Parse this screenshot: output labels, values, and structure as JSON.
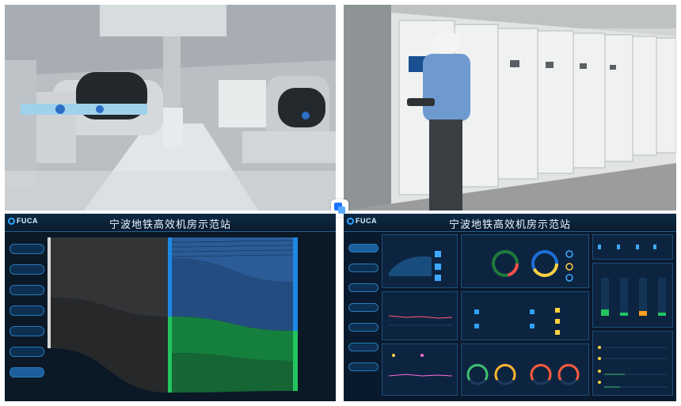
{
  "screens": {
    "title": "宁波地铁高效机房示范站",
    "brand": "FUCA"
  },
  "photos": {
    "chiller_room": "chiller plant room with insulated pipes",
    "cabinet_room": "technician operating control cabinets"
  },
  "icons": {
    "center_badge": "app-badge-icon"
  }
}
